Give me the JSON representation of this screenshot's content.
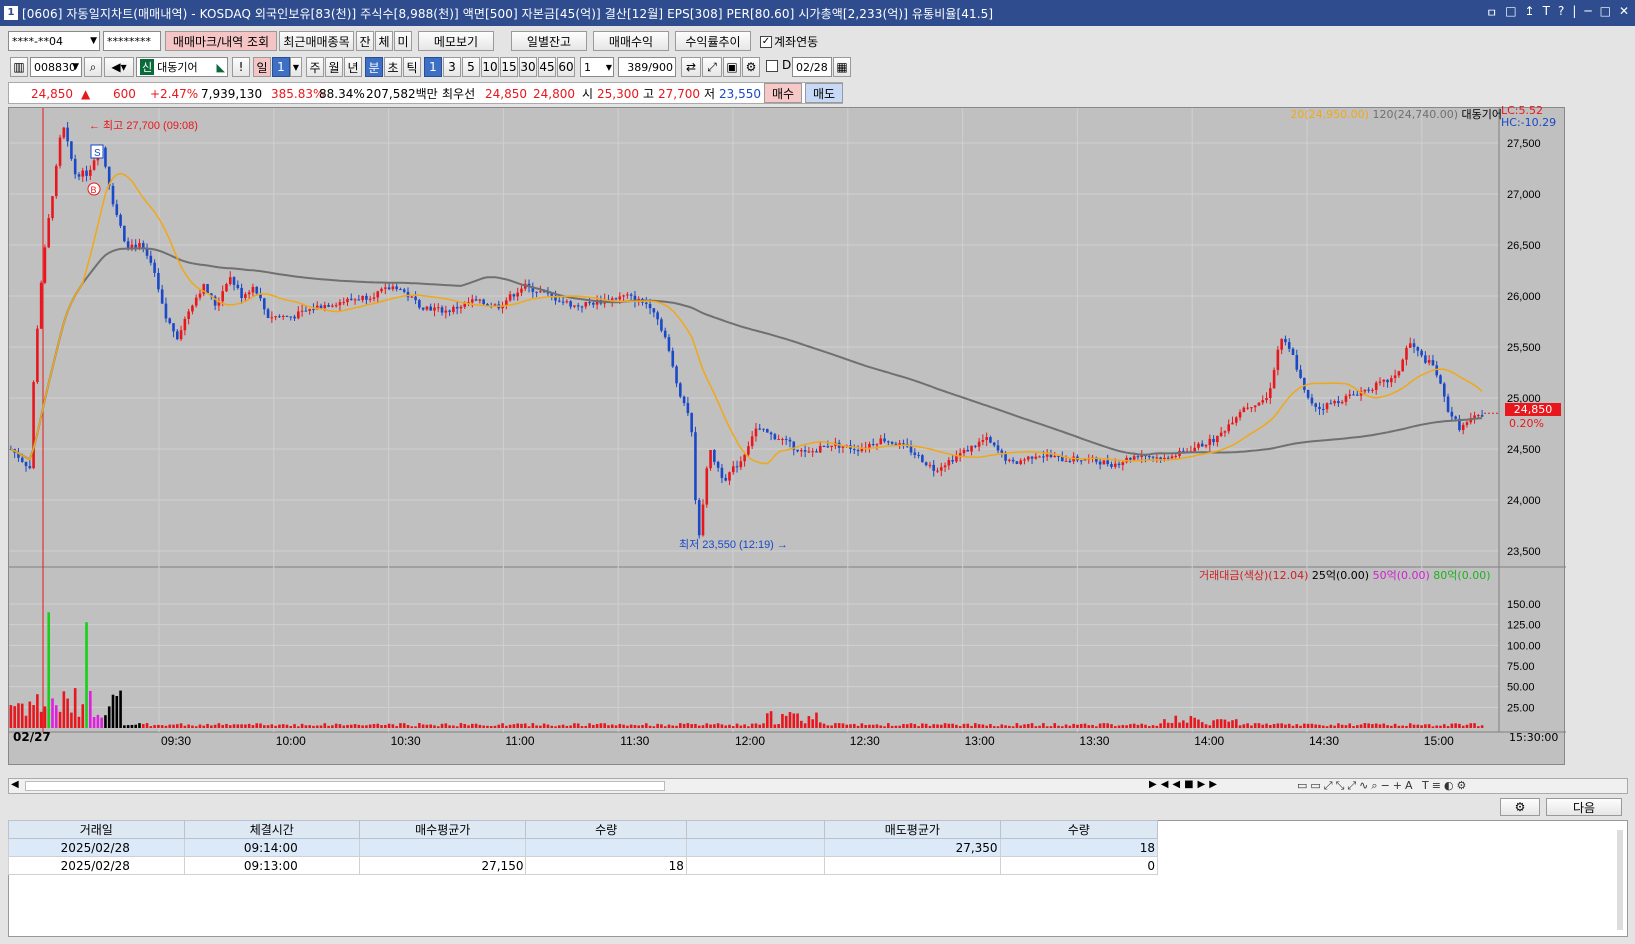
{
  "window": {
    "number": "1",
    "title": "[0606] 자동일지차트(매매내역) - KOSDAQ 외국인보유[83(천)] 주식수[8,988(천)] 액면[500] 자본금[45(억)] 결산[12월] EPS[308] PER[80.60] 시가총액[2,233(억)] 유통비율[41.5]",
    "controls": [
      "ㅁ",
      "□",
      "↥",
      "T",
      "?",
      "|",
      "─",
      "□",
      "✕"
    ]
  },
  "toolbar1": {
    "account": "****-**04",
    "password": "********",
    "btn_trade_mark": "매매마크/내역 조회",
    "btn_recent": "최근매매종목",
    "btn_jan": "잔",
    "btn_che": "체",
    "btn_mi": "미",
    "btn_memo": "메모보기",
    "btn_daily_balance": "일별잔고",
    "btn_trade_profit": "매매수익",
    "btn_return_trend": "수익률추이",
    "account_link_label": "계좌연동"
  },
  "toolbar2": {
    "code": "008830",
    "name_badge": "신",
    "name": "대동기어",
    "excl": "!",
    "btn_day": "일",
    "day_value": "1",
    "btn_week": "주",
    "btn_month": "월",
    "btn_year": "년",
    "btn_min": "분",
    "btn_sec": "초",
    "btn_tick": "틱",
    "periods": [
      "1",
      "3",
      "5",
      "10",
      "15",
      "30",
      "45",
      "60"
    ],
    "period_input": "1",
    "count": "389",
    "count_total": "/900",
    "d_label": "D",
    "date": "02/28"
  },
  "quote": {
    "price": "24,850",
    "arrow": "▲",
    "change": "600",
    "rate": "+2.47%",
    "volume": "7,939,130",
    "vol_ratio": "385.83%",
    "pct2": "88.34%",
    "amount": "207,582백만",
    "best_label": "최우선",
    "best_ask": "24,850",
    "best_bid": "24,800",
    "open_label": "시",
    "open": "25,300",
    "high_label": "고",
    "high": "27,700",
    "low_label": "저",
    "low": "23,550",
    "buy": "매수",
    "sell": "매도"
  },
  "chart": {
    "ma_legend_20": "20(24,950.00)",
    "ma_legend_120": "120(24,740.00)",
    "stock_label": "대동기어",
    "lc": "LC:5.52",
    "hc": "HC:-10.29",
    "high_annot": "최고 27,700 (09:08)",
    "low_annot": "최저 23,550 (12:19)",
    "price_ticks": [
      "27,500",
      "27,000",
      "26,500",
      "26,000",
      "25,500",
      "25,000",
      "24,500",
      "24,000",
      "23,500"
    ],
    "current_price": "24,850",
    "current_pct": "0.20%",
    "volume_legend": {
      "label": "거래대금(색상)(12.04)",
      "l25": "25억(0.00)",
      "l50": "50억(0.00)",
      "l80": "80억(0.00)"
    },
    "vol_ticks": [
      "150.00",
      "125.00",
      "100.00",
      "75.00",
      "50.00",
      "25.00"
    ],
    "date_label": "02/27",
    "time_ticks": [
      "09:30",
      "10:00",
      "10:30",
      "11:00",
      "11:30",
      "12:00",
      "12:30",
      "13:00",
      "13:30",
      "14:00",
      "14:30",
      "15:00"
    ],
    "end_time": "15:30:00",
    "marker_s": "S",
    "marker_b": "B",
    "colors": {
      "up": "#e8171d",
      "down": "#1a49c8",
      "ma20": "#f0a818",
      "ma120": "#707070"
    }
  },
  "bottom": {
    "next_btn": "다음",
    "columns": [
      "거래일",
      "체결시간",
      "매수평균가",
      "수량",
      "",
      "매도평균가",
      "수량"
    ],
    "rows": [
      [
        "2025/02/28",
        "09:14:00",
        "",
        "",
        "",
        "27,350",
        "18"
      ],
      [
        "2025/02/28",
        "09:13:00",
        "27,150",
        "18",
        "",
        "",
        "0"
      ]
    ]
  }
}
